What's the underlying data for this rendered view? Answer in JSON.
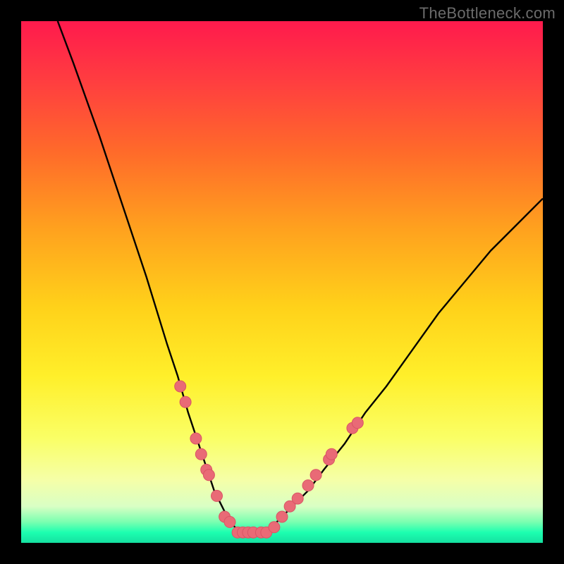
{
  "watermark": "TheBottleneck.com",
  "colors": {
    "frame": "#000000",
    "curve": "#000000",
    "marker_fill": "#e96a76",
    "marker_stroke": "#d95565"
  },
  "chart_data": {
    "type": "line",
    "title": "",
    "xlabel": "",
    "ylabel": "",
    "xlim": [
      0,
      100
    ],
    "ylim": [
      0,
      100
    ],
    "grid": false,
    "legend": false,
    "series": [
      {
        "name": "bottleneck-curve",
        "x": [
          7,
          10,
          15,
          20,
          24,
          28,
          30,
          32,
          34,
          36,
          37,
          38,
          39,
          40,
          41,
          42,
          43,
          44,
          45,
          46,
          48,
          50,
          52,
          55,
          58,
          62,
          66,
          70,
          75,
          80,
          85,
          90,
          95,
          100
        ],
        "y": [
          100,
          92,
          78,
          63,
          51,
          38,
          32,
          25,
          19,
          13,
          10,
          8,
          6,
          4,
          3,
          2,
          2,
          2,
          2,
          2,
          3,
          5,
          7,
          10,
          14,
          19,
          25,
          30,
          37,
          44,
          50,
          56,
          61,
          66
        ]
      }
    ],
    "markers": [
      {
        "x": 30.5,
        "y": 30
      },
      {
        "x": 31.5,
        "y": 27
      },
      {
        "x": 33.5,
        "y": 20
      },
      {
        "x": 34.5,
        "y": 17
      },
      {
        "x": 35.5,
        "y": 14
      },
      {
        "x": 36.0,
        "y": 13
      },
      {
        "x": 37.5,
        "y": 9
      },
      {
        "x": 39.0,
        "y": 5
      },
      {
        "x": 40.0,
        "y": 4
      },
      {
        "x": 41.5,
        "y": 2
      },
      {
        "x": 42.5,
        "y": 2
      },
      {
        "x": 43.5,
        "y": 2
      },
      {
        "x": 44.5,
        "y": 2
      },
      {
        "x": 46.0,
        "y": 2
      },
      {
        "x": 47.0,
        "y": 2
      },
      {
        "x": 48.5,
        "y": 3
      },
      {
        "x": 50.0,
        "y": 5
      },
      {
        "x": 51.5,
        "y": 7
      },
      {
        "x": 53.0,
        "y": 8.5
      },
      {
        "x": 55.0,
        "y": 11
      },
      {
        "x": 56.5,
        "y": 13
      },
      {
        "x": 59.0,
        "y": 16
      },
      {
        "x": 59.5,
        "y": 17
      },
      {
        "x": 63.5,
        "y": 22
      },
      {
        "x": 64.5,
        "y": 23
      }
    ]
  }
}
